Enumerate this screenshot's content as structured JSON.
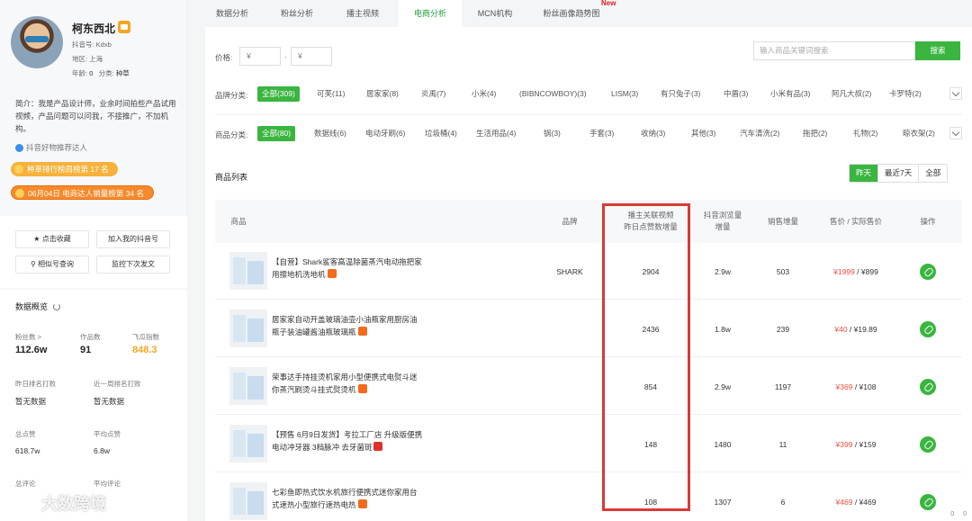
{
  "profile": {
    "name": "柯东西北",
    "id_line": "抖音号:  Kdxb",
    "region_line": "地区:  上海",
    "age_label": "年龄:",
    "age_value": "0",
    "category_label": "分类:",
    "category_value": "种草",
    "bio": "简介：我是产品设计师，业余时间拍些产品试用视频，产品问题可以问我，不接推广，不加机构。",
    "verification": "抖音好物推荐达人",
    "rank_badges": [
      "种草排行榜周榜第 17 名",
      "06月04日 电商达人销量榜第 34 名"
    ],
    "actions": [
      "点击收藏",
      "加入我的抖音号",
      "相似号查询",
      "监控下次发文"
    ]
  },
  "overview": {
    "title": "数据概览",
    "stats": [
      {
        "label": "粉丝数 >",
        "value": "112.6w"
      },
      {
        "label": "作品数",
        "value": "91"
      },
      {
        "label": "飞瓜指数",
        "value": "848.3"
      }
    ],
    "rank_stats": [
      {
        "label": "昨日排名打败",
        "value": "暂无数据"
      },
      {
        "label": "近一周排名打败",
        "value": "暂无数据"
      }
    ],
    "totals": [
      {
        "label": "总点赞",
        "value": "618.7w"
      },
      {
        "label": "平均点赞",
        "value": "6.8w"
      },
      {
        "label": "总评论",
        "value": ""
      },
      {
        "label": "平均评论",
        "value": ""
      }
    ]
  },
  "tabs": [
    {
      "label": "数据分析",
      "active": false
    },
    {
      "label": "粉丝分析",
      "active": false
    },
    {
      "label": "播主视频",
      "active": false
    },
    {
      "label": "电商分析",
      "active": true
    },
    {
      "label": "MCN机构",
      "active": false
    },
    {
      "label": "粉丝画像趋势图",
      "active": false
    }
  ],
  "new_tag": "New",
  "filters": {
    "price_label": "价格:",
    "price_min_placeholder": "¥",
    "price_max_placeholder": "¥",
    "price_dash": "-",
    "search_placeholder": "输入商品关键词搜索",
    "search_button": "搜索",
    "brand_label": "品牌分类:",
    "brands": [
      "全部(309)",
      "可芙(11)",
      "居家家(8)",
      "炎禹(7)",
      "小米(4)",
      "(BIBNCOWBOY)(3)",
      "LISM(3)",
      "有只兔子(3)",
      "中盾(3)",
      "小米有品(3)",
      "阿凡大叔(2)",
      "卡罗特(2)"
    ],
    "goods_label": "商品分类:",
    "goods": [
      "全部(80)",
      "数据线(6)",
      "电动牙刷(6)",
      "垃圾桶(4)",
      "生活用品(4)",
      "锅(3)",
      "手套(3)",
      "收纳(3)",
      "其他(3)",
      "汽车清洗(2)",
      "拖把(2)",
      "礼物(2)",
      "晾衣架(2)"
    ]
  },
  "product_list": {
    "title": "商品列表",
    "periods": [
      "昨天",
      "最近7天",
      "全部"
    ],
    "active_period": "昨天",
    "columns": [
      "商品",
      "品牌",
      "播主关联视频\n昨日点赞数增量",
      "抖音浏览量\n增量",
      "销售增量",
      "售价 / 实际售价",
      "操作"
    ],
    "rows": [
      {
        "name": "【自营】Shark鲨客高温除菌蒸汽电动拖把家用擦地机洗地机",
        "brand": "SHARK",
        "likes": "2904",
        "views": "2.9w",
        "sales": "503",
        "price": "¥1999",
        "actual": "¥899",
        "badge": "orange"
      },
      {
        "name": "居家家自动开盖玻璃油壶小油瓶家用厨房油瓶子装油罐酱油瓶玻璃瓶",
        "brand": "",
        "likes": "2436",
        "views": "1.8w",
        "sales": "239",
        "price": "¥40",
        "actual": "¥19.89",
        "badge": "orange"
      },
      {
        "name": "荣事达手持挂烫机家用小型便携式电熨斗迷你蒸汽刷烫斗挂式熨烫机",
        "brand": "",
        "likes": "854",
        "views": "2.9w",
        "sales": "1197",
        "price": "¥369",
        "actual": "¥108",
        "badge": "orange"
      },
      {
        "name": "【预售 6月9日发货】考拉工厂店 升级版便携电动冲牙器 3档脉冲 去牙菌斑",
        "brand": "",
        "likes": "148",
        "views": "1480",
        "sales": "11",
        "price": "¥399",
        "actual": "¥159",
        "badge": "red"
      },
      {
        "name": "七彩鱼即热式饮水机旅行便携式迷你家用台式速热小型旅行速热电热",
        "brand": "",
        "likes": "108",
        "views": "1307",
        "sales": "6",
        "price": "¥469",
        "actual": "¥469",
        "badge": "orange"
      }
    ]
  },
  "watermark": "大数跨境",
  "status_items": [
    "0",
    "0"
  ]
}
